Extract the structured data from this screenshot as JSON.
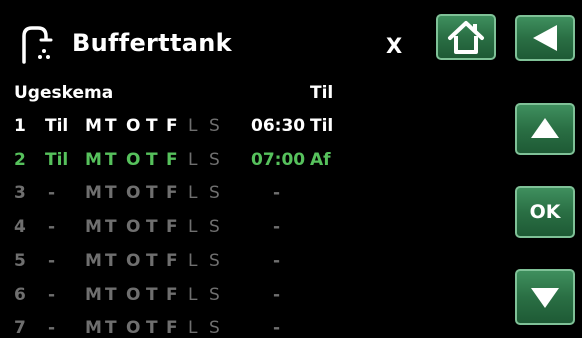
{
  "header": {
    "title": "Bufferttank",
    "close_label": "X"
  },
  "table": {
    "title": "Ugeskema",
    "state_header": "Til",
    "rows": [
      {
        "num": "1",
        "status": "Til",
        "days": [
          "M",
          "T",
          "O",
          "T",
          "F",
          "L",
          "S"
        ],
        "time": "06:30",
        "state": "Til",
        "style": "active"
      },
      {
        "num": "2",
        "status": "Til",
        "days": [
          "M",
          "T",
          "O",
          "T",
          "F",
          "L",
          "S"
        ],
        "time": "07:00",
        "state": "Af",
        "style": "selected"
      },
      {
        "num": "3",
        "status": "-",
        "days": [
          "M",
          "T",
          "O",
          "T",
          "F",
          "L",
          "S"
        ],
        "time": "-",
        "state": "",
        "style": "inactive"
      },
      {
        "num": "4",
        "status": "-",
        "days": [
          "M",
          "T",
          "O",
          "T",
          "F",
          "L",
          "S"
        ],
        "time": "-",
        "state": "",
        "style": "inactive"
      },
      {
        "num": "5",
        "status": "-",
        "days": [
          "M",
          "T",
          "O",
          "T",
          "F",
          "L",
          "S"
        ],
        "time": "-",
        "state": "",
        "style": "inactive"
      },
      {
        "num": "6",
        "status": "-",
        "days": [
          "M",
          "T",
          "O",
          "T",
          "F",
          "L",
          "S"
        ],
        "time": "-",
        "state": "",
        "style": "inactive"
      },
      {
        "num": "7",
        "status": "-",
        "days": [
          "M",
          "T",
          "O",
          "T",
          "F",
          "L",
          "S"
        ],
        "time": "-",
        "state": "",
        "style": "inactive"
      }
    ]
  },
  "nav": {
    "ok_label": "OK"
  },
  "icons": {
    "header": "hot-water-tap-icon",
    "home": "home-icon",
    "back": "back-arrow-icon",
    "up": "up-arrow-icon",
    "down": "down-arrow-icon"
  },
  "colors": {
    "background": "#000000",
    "text_active": "#ffffff",
    "text_selected": "#56c15c",
    "text_inactive": "#6f6f6f",
    "button_fill": "#2a6f44",
    "button_border": "#7fc197"
  }
}
